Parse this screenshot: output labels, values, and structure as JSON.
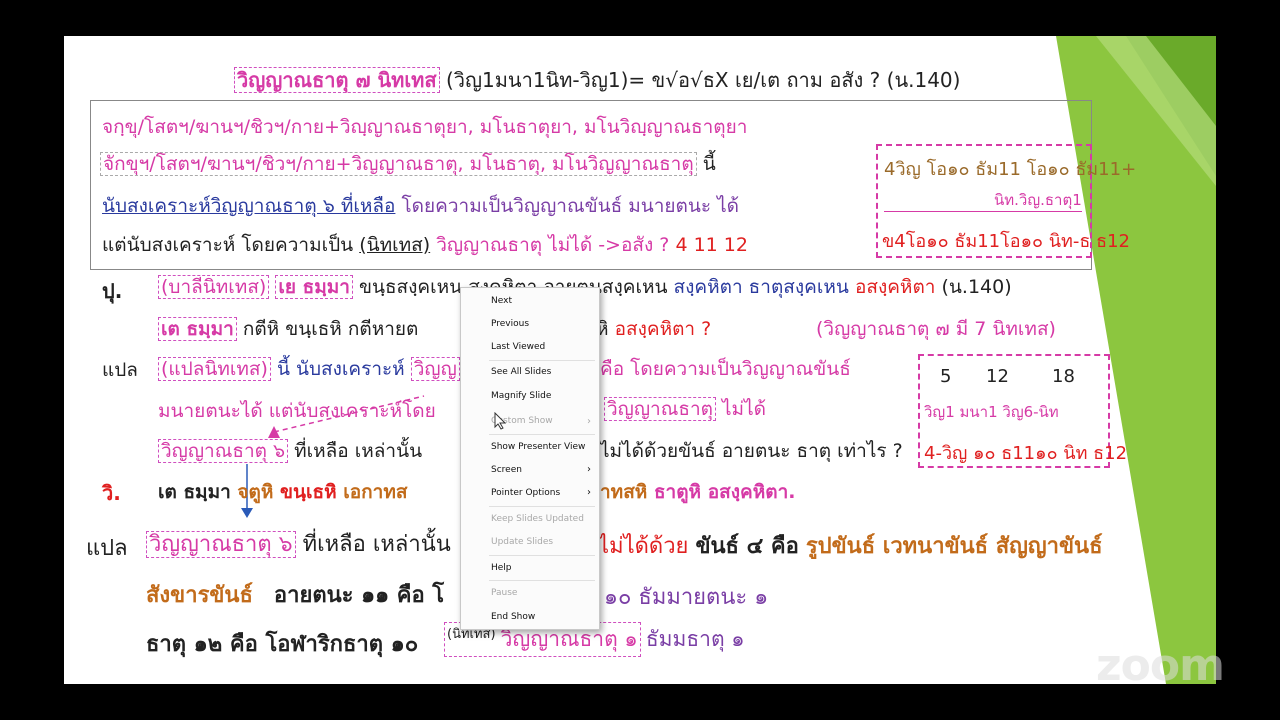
{
  "title": {
    "main": "วิญญาณธาตุ ๗ นิทเทส",
    "formula": "(วิญ1มนา1นิท-วิญ1)= ข√อ√ธX  เย/เต ถาม อสัง ? (น.140)"
  },
  "box1": {
    "line1": "จกฺขุ/โสตฯ/ฆานฯ/ชิวฯ/กาย+วิญฺญาณธาตุยา, มโนธาตุยา, มโนวิญฺญาณธาตุยา",
    "line2": "จักขุฯ/โสตฯ/ฆานฯ/ชิวฯ/กาย+วิญญาณธาตุ, มโนธาตุ, มโนวิญญาณธาตุ",
    "line2_end": "นี้",
    "line3a": "นับสงเคราะห์วิญญาณธาตุ ๖ ที่เหลือ",
    "line3b": "โดยความเป็นวิญญาณขันธ์ มนายตนะ ได้",
    "line4a": "แต่นับสงเคราะห์ โดยความเป็น",
    "line4b": "(นิทเทส)",
    "line4c": "วิญญาณธาตุ ไม่ได้ ->อสัง ?",
    "line4d": "4 11 12"
  },
  "right_box1": {
    "row1": "4วิญ  โอ๑๐ ธัม11 โอ๑๐ ธัม11+",
    "row2": "นิท.วิญ.ธาตุ1",
    "row3": "ข4โอ๑๐ ธัม11โอ๑๐ นิท-ธ ธ12"
  },
  "pali": {
    "label": "ปุ.",
    "tag": "(บาลีนิทเทส)",
    "ye": "เย ธมฺมา",
    "text1": "ขนฺธสงฺคเหน สงฺคหิตา อายตนสงฺคเหน",
    "text2": "สงฺคหิตา ธาตุสงฺคเหน",
    "asang": "อสงฺคหิตา",
    "ref": "(น.140)",
    "te": "เต ธมฺมา",
    "text3": "กตีหิ ขนฺเธหิ  กตีหายต",
    "text4": "หิ",
    "asang2": "อสงฺคหิตา ?",
    "note": "(วิญญาณธาตุ ๗ มี 7 นิทเทส)"
  },
  "trans1": {
    "label": "แปล",
    "tag": "(แปลนิทเทส)",
    "text1": "นี้ นับสงเคราะห์",
    "vinya": "วิญญ",
    "text2": "คือ โดยความเป็นวิญญาณขันธ์",
    "text3": "มนายตนะได้  แต่นับสงเคราะห์โดย",
    "vinya2": "วิญญาณธาตุ",
    "notok": "ไม่ได้",
    "vinya6": "วิญญาณธาตุ ๖",
    "text4": "ที่เหลือ เหล่านั้น",
    "text5": "ไม่ได้ด้วยขันธ์ อายตนะ ธาตุ เท่าไร ?"
  },
  "right_box2": {
    "top": [
      "5",
      "12",
      "18"
    ],
    "mid": "วิญ1   มนา1   วิญ6-นิท",
    "bottom": "4-วิญ ๑๐ ธ11๑๐ นิท ธ12"
  },
  "vi": {
    "label": "วิ.",
    "te": "เต ธมฺมา",
    "a": "จตูหิ",
    "b": "ขนฺเธหิ",
    "c": "เอกาทส",
    "d": "าทสหิ",
    "e": "ธาตูหิ",
    "f": "อสงฺคหิตา."
  },
  "trans2": {
    "label": "แปล",
    "vinya6": "วิญญาณธาตุ ๖",
    "text1": "ที่เหลือ เหล่านั้น",
    "text2": "ไม่ได้ด้วย",
    "text3": "ขันธ์ ๔ คือ",
    "khan": "รูปขันธ์ เวทนาขันธ์ สัญญาขันธ์",
    "sankhara": "สังขารขันธ์",
    "ayatana": "อายตนะ ๑๑ คือ โ",
    "ayatana_end": "๑๐  ธัมมายตนะ ๑",
    "dhatu": "ธาตุ ๑๒ คือ โอฬาริกธาตุ ๑๐",
    "nit": "(นิทเทส)",
    "vinya1": "วิญญาณธาตุ ๑",
    "dhamma": "ธัมมธาตุ ๑"
  },
  "context_menu": {
    "items": [
      {
        "label": "Next",
        "disabled": false
      },
      {
        "label": "Previous",
        "disabled": false
      },
      {
        "label": "Last Viewed",
        "disabled": false
      },
      {
        "label": "See All Slides",
        "disabled": false
      },
      {
        "label": "Magnify Slide",
        "disabled": false
      },
      {
        "label": "Custom Show",
        "disabled": true
      },
      {
        "label": "Show Presenter View",
        "disabled": false
      },
      {
        "label": "Screen",
        "disabled": false
      },
      {
        "label": "Pointer Options",
        "disabled": false
      },
      {
        "label": "Keep Slides Updated",
        "disabled": true
      },
      {
        "label": "Update Slides",
        "disabled": true
      },
      {
        "label": "Help",
        "disabled": false
      },
      {
        "label": "Pause",
        "disabled": true
      },
      {
        "label": "End Show",
        "disabled": false
      }
    ]
  },
  "watermark": "zoom",
  "colors": {
    "pink": "#d63aa6",
    "red": "#e02020",
    "green_deco": "#7cbf3a",
    "blue": "#2a3a9e"
  }
}
